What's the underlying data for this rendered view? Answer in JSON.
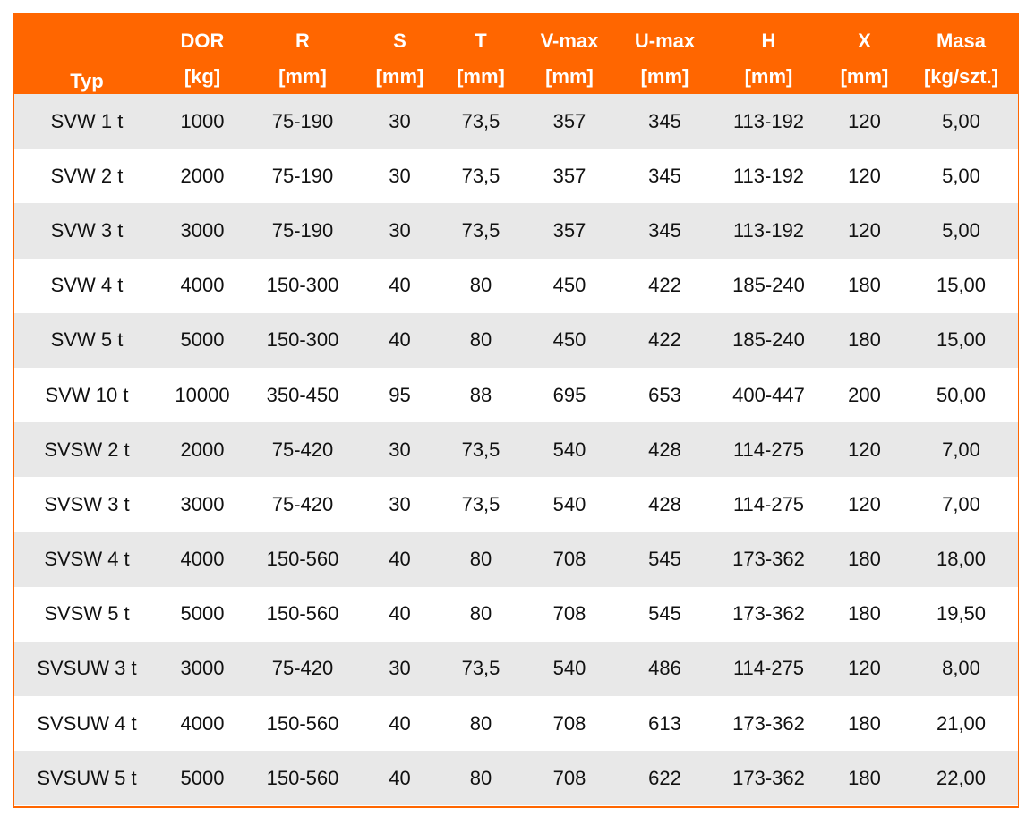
{
  "header": {
    "typ": "Typ",
    "columns": [
      {
        "name": "DOR",
        "unit": "[kg]"
      },
      {
        "name": "R",
        "unit": "[mm]"
      },
      {
        "name": "S",
        "unit": "[mm]"
      },
      {
        "name": "T",
        "unit": "[mm]"
      },
      {
        "name": "V-max",
        "unit": "[mm]"
      },
      {
        "name": "U-max",
        "unit": "[mm]"
      },
      {
        "name": "H",
        "unit": "[mm]"
      },
      {
        "name": "X",
        "unit": "[mm]"
      },
      {
        "name": "Masa",
        "unit": "[kg/szt.]"
      }
    ]
  },
  "rows": [
    [
      "SVW 1 t",
      "1000",
      "75-190",
      "30",
      "73,5",
      "357",
      "345",
      "113-192",
      "120",
      "5,00"
    ],
    [
      "SVW 2 t",
      "2000",
      "75-190",
      "30",
      "73,5",
      "357",
      "345",
      "113-192",
      "120",
      "5,00"
    ],
    [
      "SVW 3 t",
      "3000",
      "75-190",
      "30",
      "73,5",
      "357",
      "345",
      "113-192",
      "120",
      "5,00"
    ],
    [
      "SVW 4 t",
      "4000",
      "150-300",
      "40",
      "80",
      "450",
      "422",
      "185-240",
      "180",
      "15,00"
    ],
    [
      "SVW 5 t",
      "5000",
      "150-300",
      "40",
      "80",
      "450",
      "422",
      "185-240",
      "180",
      "15,00"
    ],
    [
      "SVW 10 t",
      "10000",
      "350-450",
      "95",
      "88",
      "695",
      "653",
      "400-447",
      "200",
      "50,00"
    ],
    [
      "SVSW 2 t",
      "2000",
      "75-420",
      "30",
      "73,5",
      "540",
      "428",
      "114-275",
      "120",
      "7,00"
    ],
    [
      "SVSW 3 t",
      "3000",
      "75-420",
      "30",
      "73,5",
      "540",
      "428",
      "114-275",
      "120",
      "7,00"
    ],
    [
      "SVSW 4 t",
      "4000",
      "150-560",
      "40",
      "80",
      "708",
      "545",
      "173-362",
      "180",
      "18,00"
    ],
    [
      "SVSW 5 t",
      "5000",
      "150-560",
      "40",
      "80",
      "708",
      "545",
      "173-362",
      "180",
      "19,50"
    ],
    [
      "SVSUW 3 t",
      "3000",
      "75-420",
      "30",
      "73,5",
      "540",
      "486",
      "114-275",
      "120",
      "8,00"
    ],
    [
      "SVSUW 4 t",
      "4000",
      "150-560",
      "40",
      "80",
      "708",
      "613",
      "173-362",
      "180",
      "21,00"
    ],
    [
      "SVSUW 5 t",
      "5000",
      "150-560",
      "40",
      "80",
      "708",
      "622",
      "173-362",
      "180",
      "22,00"
    ]
  ],
  "colors": {
    "header_bg": "#ff6600",
    "header_text": "#ffffff",
    "row_alt_bg": "#e8e8e8",
    "row_bg": "#ffffff"
  }
}
